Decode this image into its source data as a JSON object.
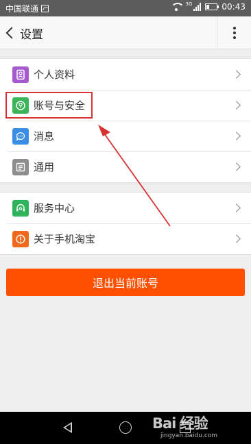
{
  "status_bar": {
    "carrier": "中国联通",
    "network": "3G",
    "time": "00:43"
  },
  "header": {
    "title": "设置"
  },
  "settings": {
    "group1": [
      {
        "label": "个人资料",
        "icon": "person-card-icon",
        "color": "#a65ad0"
      },
      {
        "label": "账号与安全",
        "icon": "shield-icon",
        "color": "#3cb45a"
      },
      {
        "label": "消息",
        "icon": "chat-bubble-icon",
        "color": "#3b8ee6"
      },
      {
        "label": "通用",
        "icon": "general-icon",
        "color": "#8e8e8e"
      }
    ],
    "group2": [
      {
        "label": "服务中心",
        "icon": "headset-icon",
        "color": "#2fb45b"
      },
      {
        "label": "关于手机淘宝",
        "icon": "info-icon",
        "color": "#f06a1e"
      }
    ]
  },
  "logout_button": {
    "label": "退出当前账号",
    "color": "#ff5000"
  },
  "annotation": {
    "highlight_color": "#d93232",
    "highlighted_item": "账号与安全"
  },
  "watermark": {
    "main": "Bai 经验",
    "sub": "jingyan.baidu.com"
  }
}
